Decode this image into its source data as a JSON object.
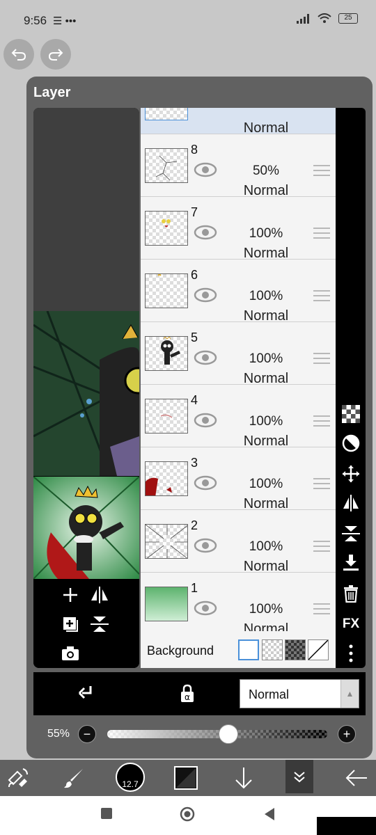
{
  "status_bar": {
    "time": "9:56",
    "left_icons": "☰ •••",
    "battery": "25"
  },
  "panel": {
    "title": "Layer"
  },
  "layers": [
    {
      "number": "8",
      "opacity": "50%",
      "mode": "Normal"
    },
    {
      "number": "7",
      "opacity": "100%",
      "mode": "Normal"
    },
    {
      "number": "6",
      "opacity": "100%",
      "mode": "Normal"
    },
    {
      "number": "5",
      "opacity": "100%",
      "mode": "Normal"
    },
    {
      "number": "4",
      "opacity": "100%",
      "mode": "Normal"
    },
    {
      "number": "3",
      "opacity": "100%",
      "mode": "Normal"
    },
    {
      "number": "2",
      "opacity": "100%",
      "mode": "Normal"
    },
    {
      "number": "1",
      "opacity": "100%",
      "mode": "Normal"
    }
  ],
  "selected_layer": {
    "mode": "Normal"
  },
  "background": {
    "label": "Background"
  },
  "right_toolbar": {
    "fx_label": "FX"
  },
  "blend": {
    "value": "Normal",
    "arrow": "▲"
  },
  "opacity": {
    "label": "55%",
    "value": 0.55,
    "minus": "−",
    "plus": "+"
  },
  "brush": {
    "size": "12.7"
  },
  "colors": {
    "accent": "#4a90d9",
    "panel": "#616161",
    "selected": "#d9e3f1"
  }
}
